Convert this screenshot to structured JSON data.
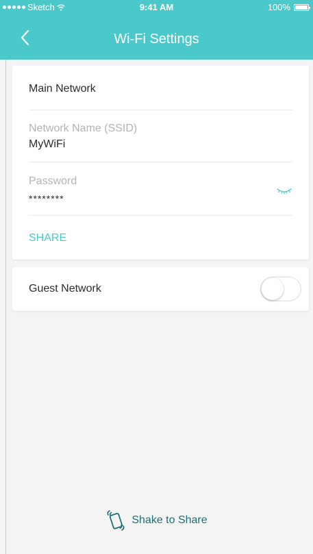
{
  "status_bar": {
    "carrier": "Sketch",
    "time": "9:41 AM",
    "battery": "100%"
  },
  "nav": {
    "title": "Wi-Fi Settings"
  },
  "main_network": {
    "title": "Main Network",
    "ssid_label": "Network Name (SSID)",
    "ssid_value": "MyWiFi",
    "password_label": "Password",
    "password_value": "********",
    "share_label": "SHARE"
  },
  "guest_network": {
    "label": "Guest Network",
    "enabled": false
  },
  "footer": {
    "shake_label": "Shake to Share"
  },
  "colors": {
    "accent": "#4bc8c9",
    "shake_text": "#1e6f73"
  },
  "icons": [
    "back-chevron-icon",
    "eye-closed-icon",
    "phone-shake-icon",
    "wifi-icon",
    "battery-icon"
  ]
}
